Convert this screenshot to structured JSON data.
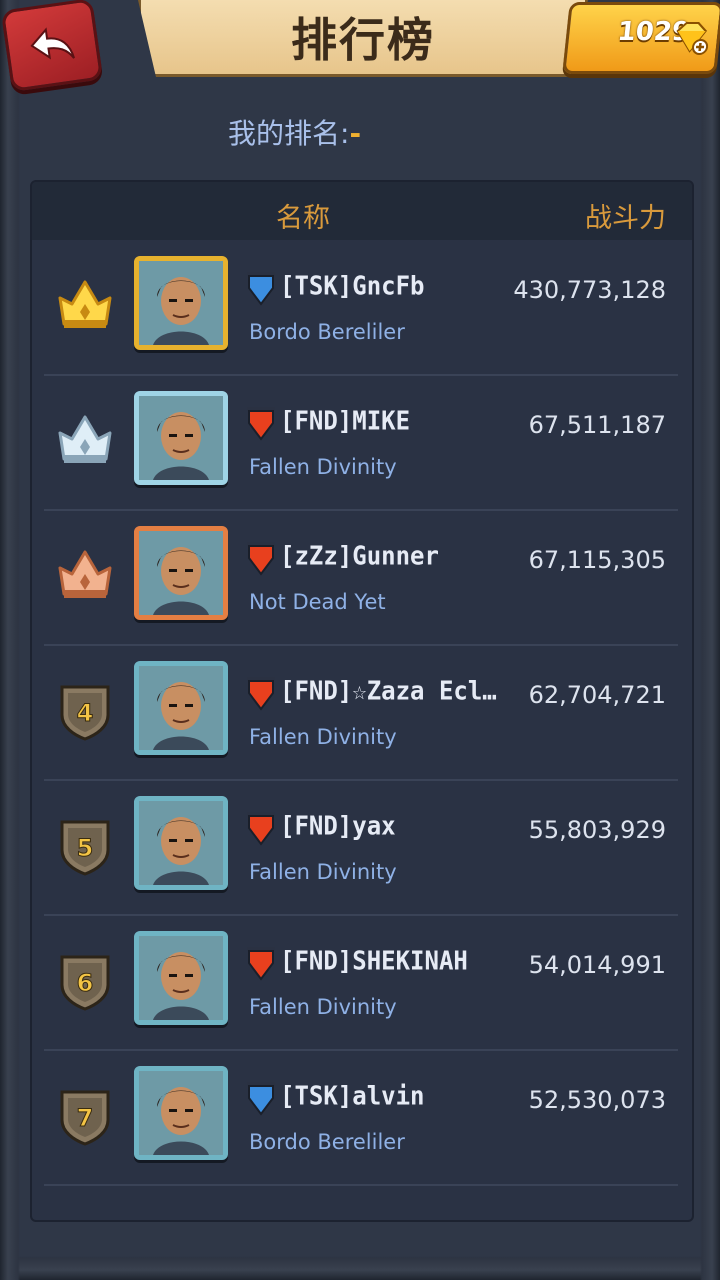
{
  "header": {
    "back_icon": "back-arrow-icon",
    "title": "排行榜",
    "gems": "1029",
    "gem_icon": "gem-plus-icon"
  },
  "my_rank": {
    "label": "我的排名:",
    "value": "-"
  },
  "table": {
    "col_name": "名称",
    "col_power": "战斗力"
  },
  "players": [
    {
      "rank": "1",
      "badge": "gold-crown-icon",
      "flag": "blue",
      "name": "[TSK]GncFb",
      "guild": "Bordo Bereliler",
      "power": "430,773,128",
      "frame": "gold"
    },
    {
      "rank": "2",
      "badge": "silver-crown-icon",
      "flag": "red",
      "name": "[FND]MIKE",
      "guild": "Fallen Divinity",
      "power": "67,511,187",
      "frame": "silver"
    },
    {
      "rank": "3",
      "badge": "bronze-crown-icon",
      "flag": "red",
      "name": "[zZz]Gunner",
      "guild": "Not Dead Yet",
      "power": "67,115,305",
      "frame": "bronze"
    },
    {
      "rank": "4",
      "badge": "rank-shield-icon",
      "flag": "red",
      "name": "[FND]☆Zaza Ecli...",
      "guild": "Fallen Divinity",
      "power": "62,704,721",
      "frame": "normal"
    },
    {
      "rank": "5",
      "badge": "rank-shield-icon",
      "flag": "red",
      "name": "[FND]yax",
      "guild": "Fallen Divinity",
      "power": "55,803,929",
      "frame": "normal"
    },
    {
      "rank": "6",
      "badge": "rank-shield-icon",
      "flag": "red",
      "name": "[FND]SHEKINAH",
      "guild": "Fallen Divinity",
      "power": "54,014,991",
      "frame": "normal"
    },
    {
      "rank": "7",
      "badge": "rank-shield-icon",
      "flag": "blue",
      "name": "[TSK]alvin",
      "guild": "Bordo Bereliler",
      "power": "52,530,073",
      "frame": "normal"
    }
  ],
  "colors": {
    "flag_blue": "#3c8ee0",
    "flag_red": "#e8401e",
    "power_header": "#d99a3c",
    "guild_text": "#8fb1e6"
  }
}
